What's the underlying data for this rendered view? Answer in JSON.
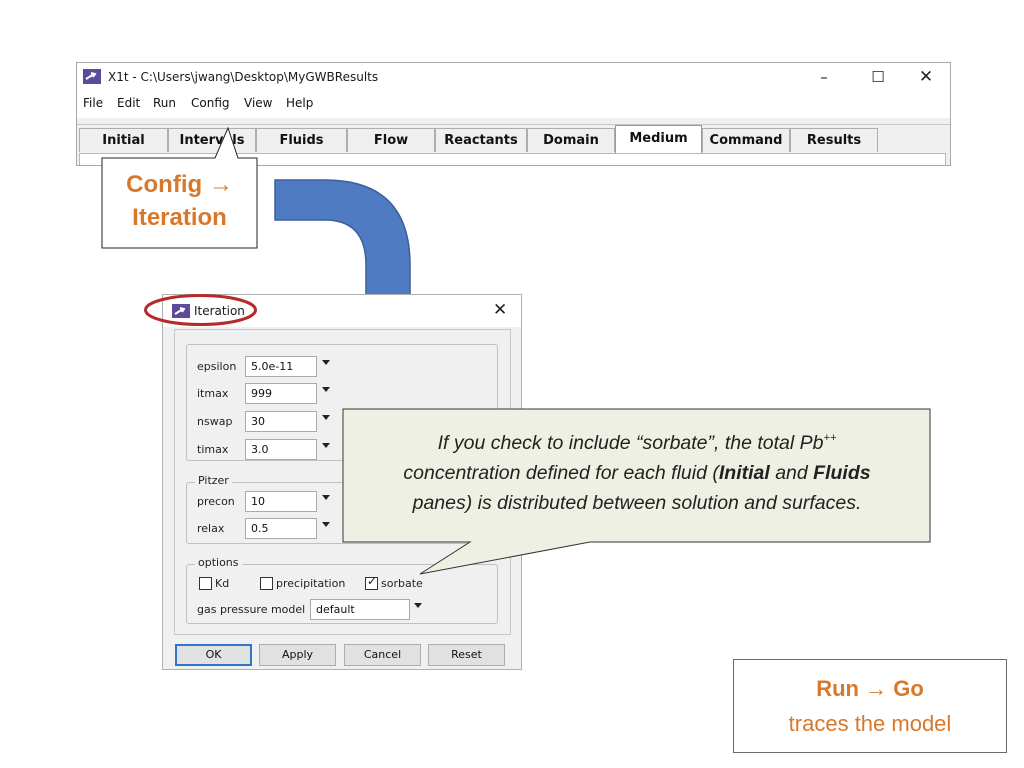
{
  "window": {
    "title": "X1t - C:\\Users\\jwang\\Desktop\\MyGWBResults",
    "controls": {
      "minimize": "–",
      "maximize": "☐",
      "close": "✕"
    }
  },
  "menubar": [
    "File",
    "Edit",
    "Run",
    "Config",
    "View",
    "Help"
  ],
  "tabs": [
    "Initial",
    "Intervals",
    "Fluids",
    "Flow",
    "Reactants",
    "Domain",
    "Medium",
    "Command",
    "Results"
  ],
  "active_tab": "Medium",
  "config_callout": {
    "line1": "Config →",
    "line2": "Iteration"
  },
  "dialog": {
    "title": "Iteration",
    "close": "✕",
    "fields": [
      {
        "label": "epsilon",
        "value": "5.0e-11"
      },
      {
        "label": "itmax",
        "value": "999"
      },
      {
        "label": "nswap",
        "value": "30"
      },
      {
        "label": "timax",
        "value": "3.0"
      }
    ],
    "pitzer": {
      "legend": "Pitzer",
      "fields": [
        {
          "label": "precon",
          "value": "10"
        },
        {
          "label": "relax",
          "value": "0.5"
        }
      ]
    },
    "options": {
      "legend": "options",
      "checkboxes": [
        {
          "label": "Kd",
          "checked": false
        },
        {
          "label": "precipitation",
          "checked": false
        },
        {
          "label": "sorbate",
          "checked": true
        }
      ],
      "gas_pressure_label": "gas pressure model",
      "gas_pressure_value": "default"
    },
    "buttons": [
      "OK",
      "Apply",
      "Cancel",
      "Reset"
    ]
  },
  "bubble": {
    "line1_prefix": "If you check to include “sorbate”, the total Pb",
    "line1_sup": "++",
    "line2_prefix": "concentration defined for each fluid (",
    "line2_initial": "Initial",
    "line2_and": " and ",
    "line2_fluids": "Fluids",
    "line3": "panes) is distributed between solution and surfaces."
  },
  "run_box": {
    "title": "Run → Go",
    "subtitle": "traces the model"
  },
  "colors": {
    "accent_orange": "#d8782a",
    "highlight_red": "#b52a2a",
    "arrow_blue": "#4f7bc2",
    "bubble_fill": "#eef0e3",
    "dialog_default_button": "#2f76c9"
  }
}
